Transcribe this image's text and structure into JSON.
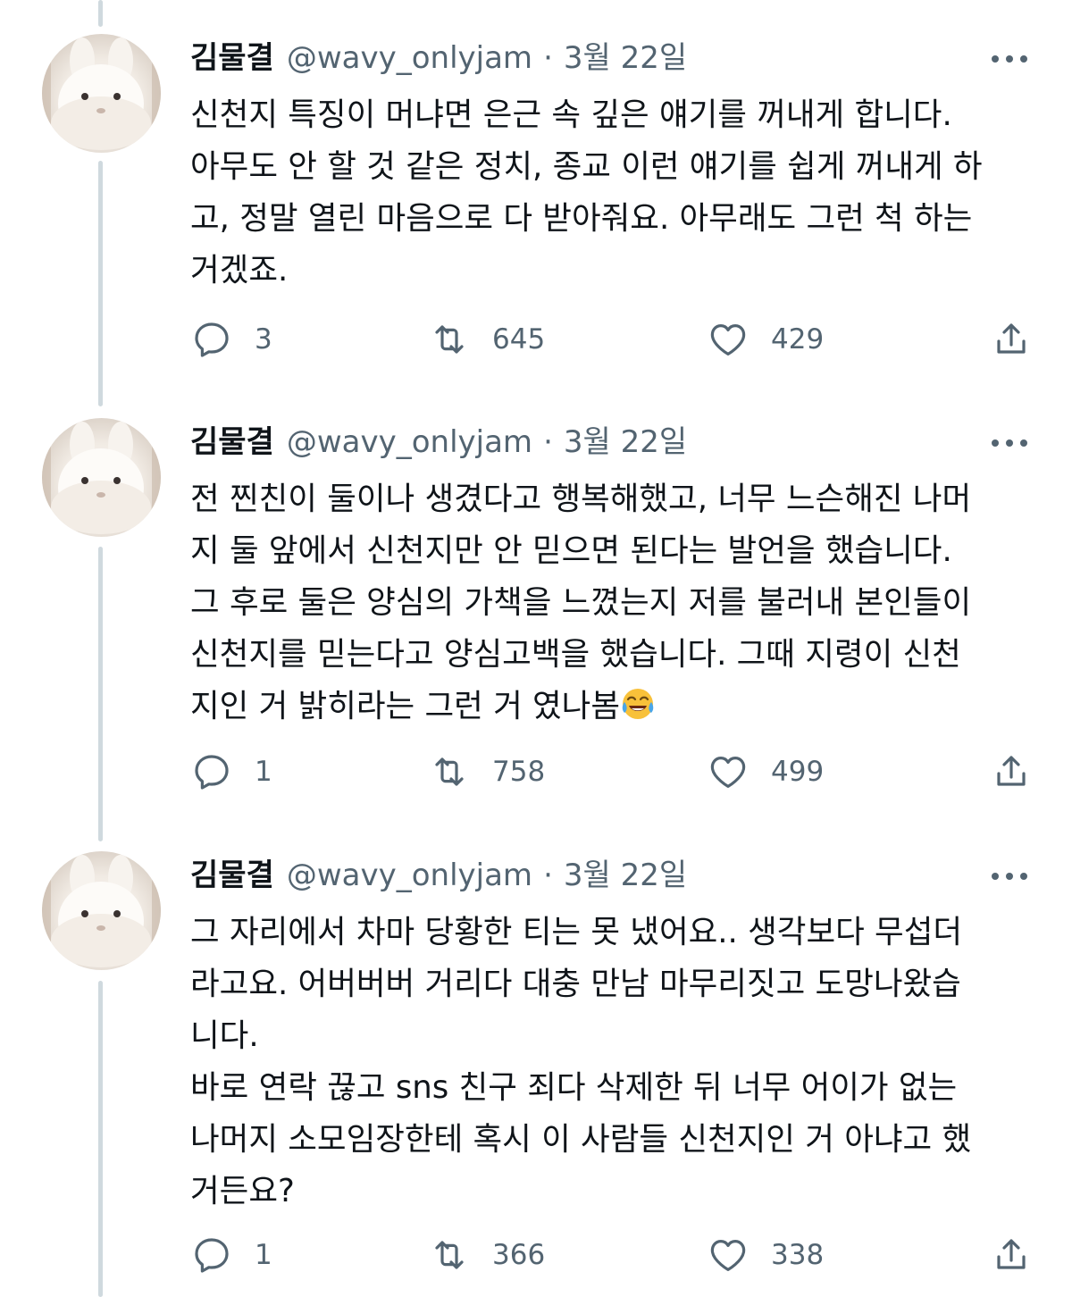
{
  "tweets": [
    {
      "name": "김물결",
      "handle": "@wavy_onlyjam",
      "separator": "·",
      "date": "3월 22일",
      "text": "신천지 특징이 머냐면 은근 속 깊은 얘기를 꺼내게 합니다.\n아무도 안 할 것 같은 정치, 종교 이런 얘기를 쉽게 꺼내게 하\n고, 정말 열린 마음으로 다 받아줘요. 아무래도 그런 척 하는\n거겠죠.",
      "emoji": "",
      "replies": "3",
      "retweets": "645",
      "likes": "429"
    },
    {
      "name": "김물결",
      "handle": "@wavy_onlyjam",
      "separator": "·",
      "date": "3월 22일",
      "text": "전 찐친이 둘이나 생겼다고 행복해했고, 너무 느슨해진 나머\n지 둘 앞에서 신천지만 안 믿으면 된다는 발언을 했습니다.\n그 후로 둘은 양심의 가책을 느꼈는지 저를 불러내 본인들이\n신천지를 믿는다고 양심고백을 했습니다. 그때 지령이 신천\n지인 거 밝히라는 그런 거 였나봄",
      "emoji": "face-with-tears-of-joy-emoji",
      "replies": "1",
      "retweets": "758",
      "likes": "499"
    },
    {
      "name": "김물결",
      "handle": "@wavy_onlyjam",
      "separator": "·",
      "date": "3월 22일",
      "text": "그 자리에서 차마 당황한 티는 못 냈어요.. 생각보다 무섭더\n라고요. 어버버버 거리다 대충 만남 마무리짓고 도망나왔습\n니다.\n바로 연락 끊고 sns 친구 죄다 삭제한 뒤 너무 어이가 없는\n나머지 소모임장한테 혹시 이 사람들 신천지인 거 아냐고 했\n거든요?",
      "emoji": "",
      "replies": "1",
      "retweets": "366",
      "likes": "338"
    }
  ],
  "icons": {
    "avatar": "white-rabbit-avatar",
    "more": "more-options-icon",
    "reply": "reply-icon",
    "retweet": "retweet-icon",
    "like": "heart-icon",
    "share": "share-icon"
  },
  "colors": {
    "text": "#0f1419",
    "secondary": "#536471",
    "thread_line": "#cfd9de"
  }
}
